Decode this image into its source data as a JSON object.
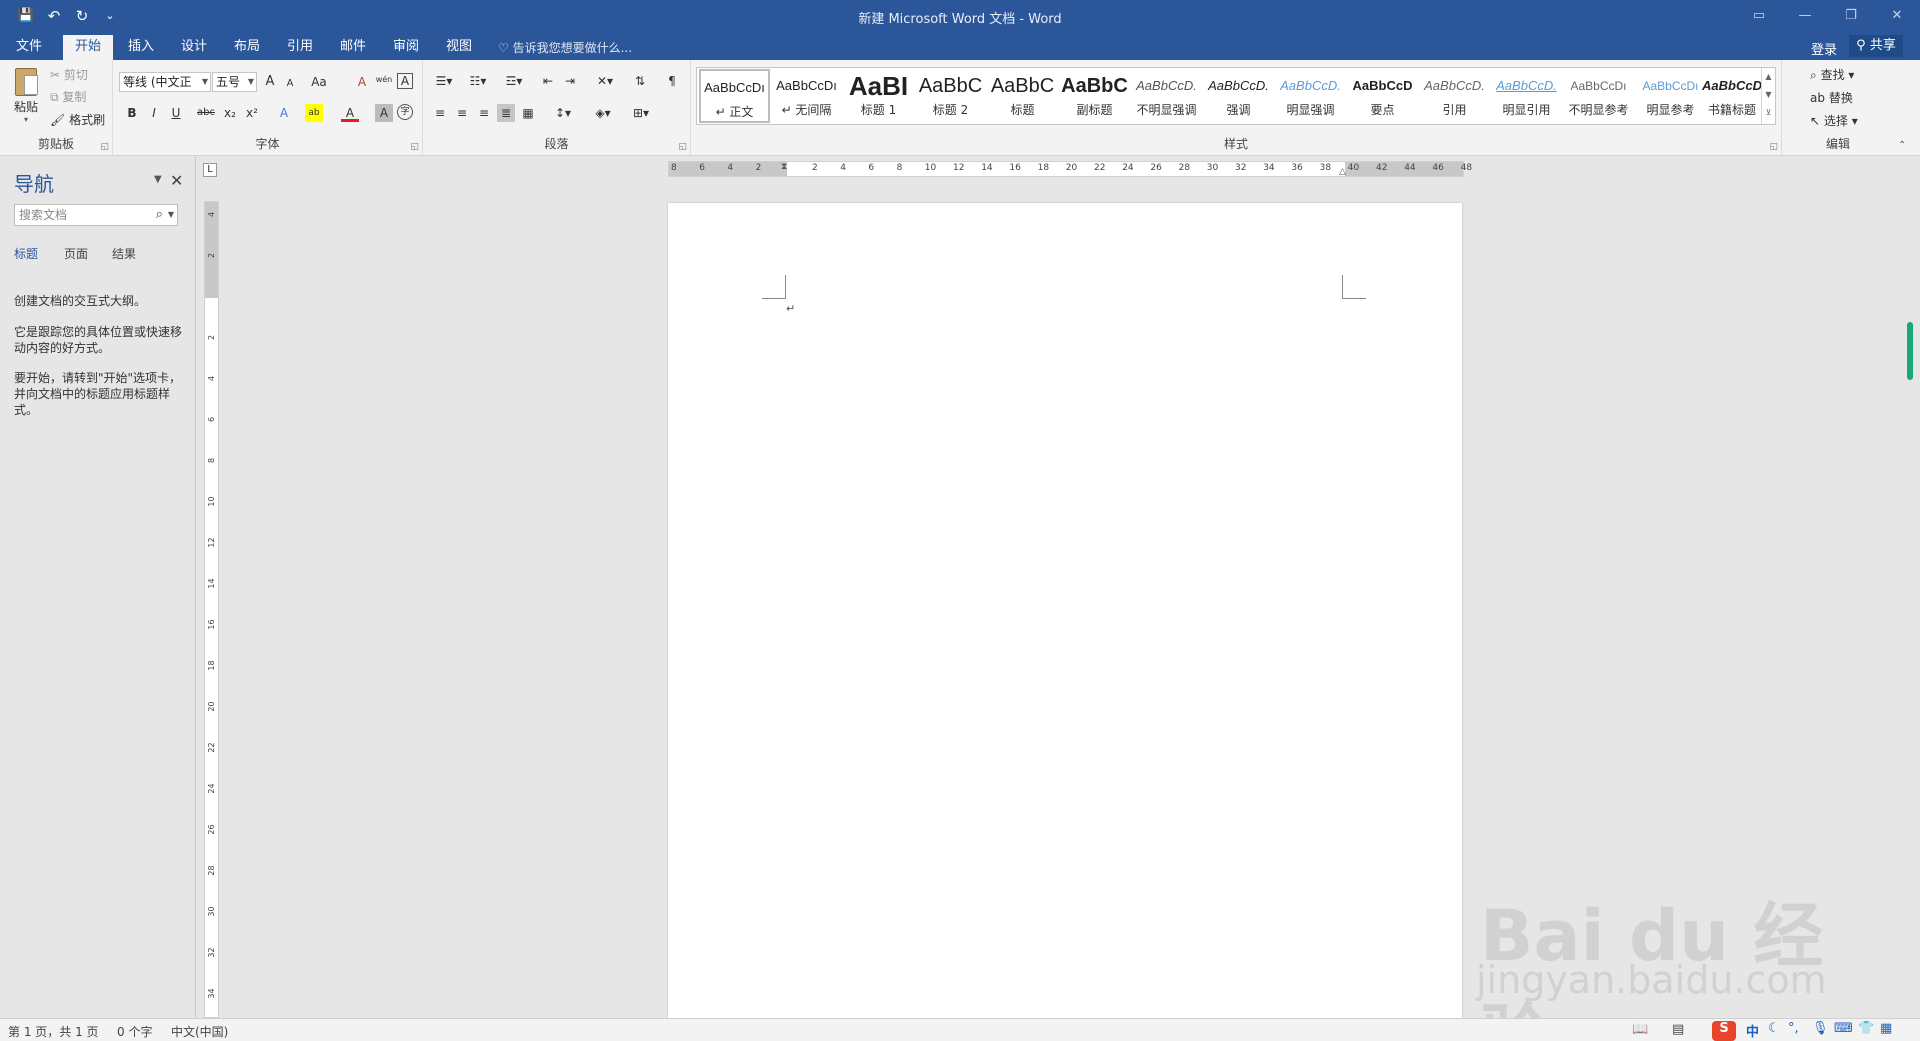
{
  "titlebar": {
    "title": "新建 Microsoft Word 文档 - Word",
    "qat_save": "💾",
    "qat_undo": "↶",
    "qat_redo": "↻",
    "qat_more": "⌄",
    "win_ribbon": "▭",
    "win_min": "—",
    "win_max": "❐",
    "win_close": "✕"
  },
  "tabs": [
    {
      "label": "文件"
    },
    {
      "label": "开始"
    },
    {
      "label": "插入"
    },
    {
      "label": "设计"
    },
    {
      "label": "布局"
    },
    {
      "label": "引用"
    },
    {
      "label": "邮件"
    },
    {
      "label": "审阅"
    },
    {
      "label": "视图"
    }
  ],
  "tellme": "告诉我您想要做什么...",
  "login": "登录",
  "share": "共享",
  "ribbon": {
    "clipboard": {
      "label": "剪贴板",
      "paste": "粘贴",
      "cut": "剪切",
      "copy": "复制",
      "format_painter": "格式刷"
    },
    "font": {
      "label": "字体",
      "font_name": "等线 (中文正",
      "font_size": "五号",
      "grow": "A",
      "shrink": "A",
      "case": "Aa",
      "clear": "A",
      "phonetic": "wén",
      "border_char": "A",
      "bold": "B",
      "italic": "I",
      "underline": "U",
      "strike": "abc",
      "subscript": "x₂",
      "superscript": "x²",
      "text_effects": "A",
      "highlight": "ab",
      "font_color": "A",
      "char_shading": "A",
      "enclose": "字"
    },
    "paragraph": {
      "label": "段落"
    },
    "styles": {
      "label": "样式",
      "items": [
        {
          "sample": "AaBbCcDı",
          "name": "↵ 正文"
        },
        {
          "sample": "AaBbCcDı",
          "name": "↵ 无间隔"
        },
        {
          "sample": "AaBI",
          "name": "标题 1"
        },
        {
          "sample": "AaBbC",
          "name": "标题 2"
        },
        {
          "sample": "AaBbC",
          "name": "标题"
        },
        {
          "sample": "AaBbC",
          "name": "副标题"
        },
        {
          "sample": "AaBbCcD.",
          "name": "不明显强调"
        },
        {
          "sample": "AaBbCcD.",
          "name": "强调"
        },
        {
          "sample": "AaBbCcD.",
          "name": "明显强调"
        },
        {
          "sample": "AaBbCcD",
          "name": "要点"
        },
        {
          "sample": "AaBbCcD.",
          "name": "引用"
        },
        {
          "sample": "AaBbCcD.",
          "name": "明显引用"
        },
        {
          "sample": "AaBbCcDı",
          "name": "不明显参考"
        },
        {
          "sample": "AaBbCcDı",
          "name": "明显参考"
        },
        {
          "sample": "AaBbCcD",
          "name": "书籍标题"
        }
      ]
    },
    "editing": {
      "label": "编辑",
      "find": "查找",
      "replace": "替换",
      "select": "选择"
    }
  },
  "nav": {
    "title": "导航",
    "search_placeholder": "搜索文档",
    "tabs": [
      "标题",
      "页面",
      "结果"
    ],
    "text1": "创建文档的交互式大纲。",
    "text2": "它是跟踪您的具体位置或快速移动内容的好方式。",
    "text3": "要开始，请转到\"开始\"选项卡，并向文档中的标题应用标题样式。"
  },
  "ruler": {
    "tab_selector": "L",
    "h_ticks": [
      "8",
      "6",
      "4",
      "2",
      "",
      "2",
      "4",
      "6",
      "8",
      "10",
      "12",
      "14",
      "16",
      "18",
      "20",
      "22",
      "24",
      "26",
      "28",
      "30",
      "32",
      "34",
      "36",
      "38",
      "40",
      "42",
      "44",
      "46",
      "48"
    ],
    "v_ticks": [
      "4",
      "2",
      "",
      "2",
      "4",
      "6",
      "8",
      "10",
      "12",
      "14",
      "16",
      "18",
      "20",
      "22",
      "24",
      "26",
      "28",
      "30",
      "32",
      "34"
    ]
  },
  "document": {
    "para_mark": "↵"
  },
  "status": {
    "page": "第 1 页，共 1 页",
    "words": "0 个字",
    "language": "中文(中国)",
    "ime_logo": "S",
    "ime_mode": "中"
  },
  "watermark": {
    "big": "Bai du 经验",
    "small": "jingyan.baidu.com"
  },
  "colors": {
    "accent": "#2b579a",
    "ime": "#e8442a"
  }
}
